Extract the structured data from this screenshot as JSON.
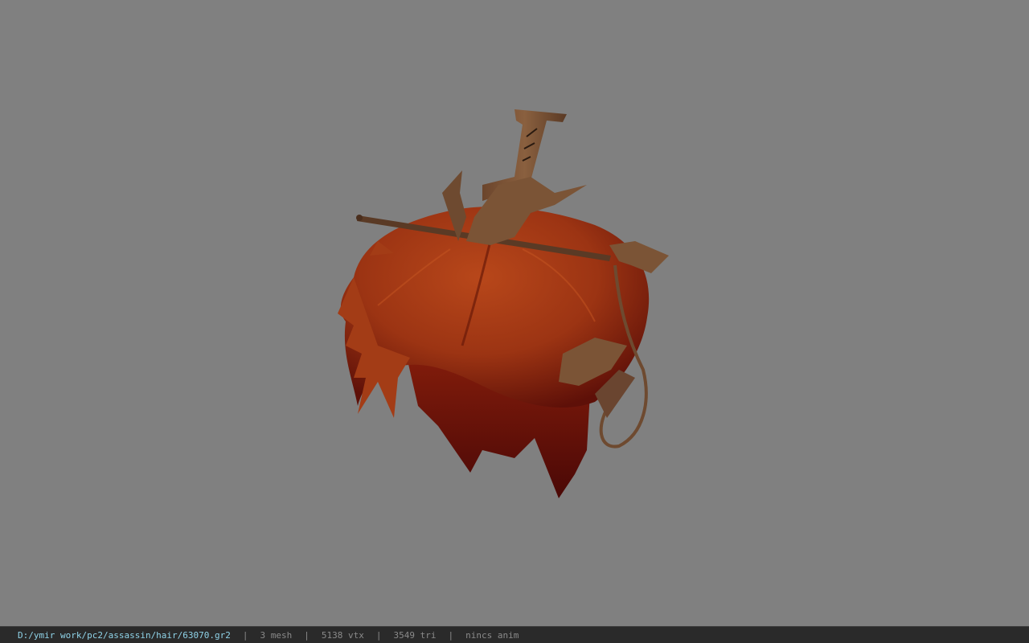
{
  "viewport": {
    "background": "#808080",
    "model": "hair-mesh"
  },
  "statusbar": {
    "file_path": "D:/ymir work/pc2/assassin/hair/63070.gr2",
    "separator": "|",
    "mesh_count": "3 mesh",
    "vertex_count": "5138 vtx",
    "triangle_count": "3549 tri",
    "anim_status": "nincs anim"
  },
  "colors": {
    "hair_main": "#a83a14",
    "hair_dark": "#6e1208",
    "accessory": "#7a5236",
    "status_path": "#8fd3e8",
    "status_text": "#8a8a8a"
  }
}
